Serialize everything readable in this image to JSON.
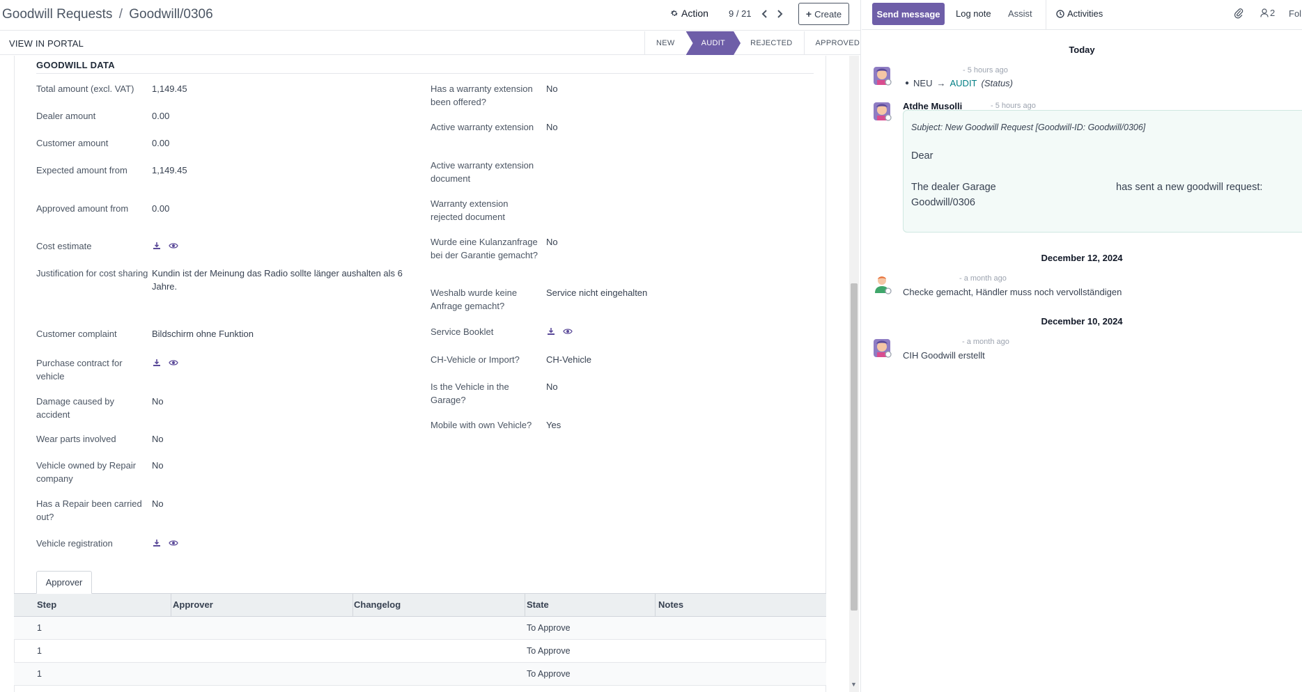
{
  "control_panel": {
    "breadcrumb_parent": "Goodwill Requests",
    "breadcrumb_sep": "/",
    "breadcrumb_current": "Goodwill/0306",
    "action_label": "Action",
    "pager_value": "9 / 21",
    "create_label": "Create"
  },
  "status_bar": {
    "portal_label": "VIEW IN PORTAL",
    "stages": [
      "NEW",
      "AUDIT",
      "REJECTED",
      "APPROVED"
    ],
    "active_stage": "AUDIT"
  },
  "form": {
    "section_title": "GOODWILL DATA",
    "left_fields": [
      {
        "label": "Total amount (excl. VAT)",
        "value": "1,149.45"
      },
      {
        "label": "Dealer amount",
        "value": "0.00"
      },
      {
        "label": "Customer amount",
        "value": "0.00"
      },
      {
        "label": "Expected amount from",
        "value": "1,149.45"
      },
      {
        "label": "Approved amount from",
        "value": "0.00"
      },
      {
        "label": "Cost estimate",
        "value": ""
      },
      {
        "label": "Justification for cost sharing",
        "value": "Kundin ist der Meinung das Radio sollte länger aushalten als 6 Jahre."
      },
      {
        "label": "Customer complaint",
        "value": "Bildschirm ohne Funktion"
      },
      {
        "label": "Purchase contract for vehicle",
        "value": ""
      },
      {
        "label": "Damage caused by accident",
        "value": "No"
      },
      {
        "label": "Wear parts involved",
        "value": "No"
      },
      {
        "label": "Vehicle owned by Repair company",
        "value": "No"
      },
      {
        "label": "Has a Repair been carried out?",
        "value": "No"
      },
      {
        "label": "Vehicle registration",
        "value": ""
      }
    ],
    "right_fields": [
      {
        "label": "Has a warranty extension been offered?",
        "value": "No"
      },
      {
        "label": "Active warranty extension",
        "value": "No"
      },
      {
        "label": "Active warranty extension document",
        "value": ""
      },
      {
        "label": "Warranty extension rejected document",
        "value": ""
      },
      {
        "label": "Wurde eine Kulanzanfrage bei der Garantie gemacht?",
        "value": "No"
      },
      {
        "label": "Weshalb wurde keine Anfrage gemacht?",
        "value": "Service nicht eingehalten"
      },
      {
        "label": "Service Booklet",
        "value": ""
      },
      {
        "label": "CH-Vehicle or Import?",
        "value": "CH-Vehicle"
      },
      {
        "label": "Is the Vehicle in the Garage?",
        "value": "No"
      },
      {
        "label": "Mobile with own Vehicle?",
        "value": "Yes"
      }
    ],
    "tab_label": "Approver",
    "table_headers": [
      "Step",
      "Approver",
      "Changelog",
      "State",
      "Notes"
    ],
    "table_rows": [
      {
        "step": "1",
        "approver": "",
        "changelog": "",
        "state": "To Approve",
        "notes": ""
      },
      {
        "step": "1",
        "approver": "",
        "changelog": "",
        "state": "To Approve",
        "notes": ""
      },
      {
        "step": "1",
        "approver": "",
        "changelog": "",
        "state": "To Approve",
        "notes": ""
      }
    ]
  },
  "chatter": {
    "send_message": "Send message",
    "log_note": "Log note",
    "assist": "Assist",
    "activities": "Activities",
    "followers_count": "2",
    "follow_label": "Fol",
    "groups": [
      {
        "date": "Today",
        "messages": [
          {
            "author": "",
            "time": "- 5 hours ago",
            "tracking_old": "NEU",
            "tracking_new": "AUDIT",
            "tracking_field": "(Status)"
          },
          {
            "author": "Atdhe Musolli",
            "time": "- 5 hours ago",
            "subject": "Subject: New Goodwill Request [Goodwill-ID: Goodwill/0306]",
            "body_greeting": "Dear",
            "body_line1_start": "The dealer Garage",
            "body_line1_end": "has sent a new goodwill request:",
            "body_line2": "Goodwill/0306"
          }
        ]
      },
      {
        "date": "December 12, 2024",
        "messages": [
          {
            "author": "",
            "time": "- a month ago",
            "text": "Checke gemacht, Händler muss noch vervollständigen"
          }
        ]
      },
      {
        "date": "December 10, 2024",
        "messages": [
          {
            "author": "",
            "time": "- a month ago",
            "text": "CIH Goodwill erstellt"
          }
        ]
      }
    ]
  },
  "colors": {
    "brand": "#6e5ea8",
    "link": "#017e84",
    "bubble_bg": "#f3faf8"
  }
}
